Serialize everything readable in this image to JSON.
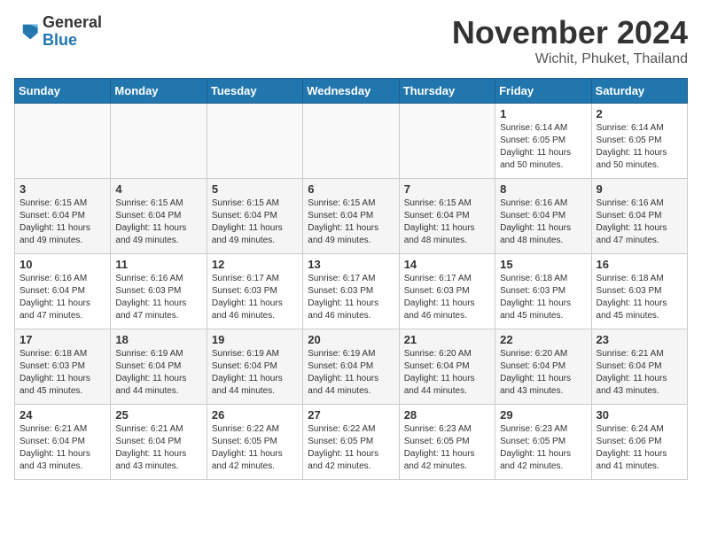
{
  "header": {
    "logo": {
      "general": "General",
      "blue": "Blue"
    },
    "month": "November 2024",
    "location": "Wichit, Phuket, Thailand"
  },
  "days_of_week": [
    "Sunday",
    "Monday",
    "Tuesday",
    "Wednesday",
    "Thursday",
    "Friday",
    "Saturday"
  ],
  "weeks": [
    [
      {
        "day": null
      },
      {
        "day": null
      },
      {
        "day": null
      },
      {
        "day": null
      },
      {
        "day": null
      },
      {
        "day": "1",
        "sunrise": "6:14 AM",
        "sunset": "6:05 PM",
        "daylight": "11 hours and 50 minutes."
      },
      {
        "day": "2",
        "sunrise": "6:14 AM",
        "sunset": "6:05 PM",
        "daylight": "11 hours and 50 minutes."
      }
    ],
    [
      {
        "day": "3",
        "sunrise": "6:15 AM",
        "sunset": "6:04 PM",
        "daylight": "11 hours and 49 minutes."
      },
      {
        "day": "4",
        "sunrise": "6:15 AM",
        "sunset": "6:04 PM",
        "daylight": "11 hours and 49 minutes."
      },
      {
        "day": "5",
        "sunrise": "6:15 AM",
        "sunset": "6:04 PM",
        "daylight": "11 hours and 49 minutes."
      },
      {
        "day": "6",
        "sunrise": "6:15 AM",
        "sunset": "6:04 PM",
        "daylight": "11 hours and 49 minutes."
      },
      {
        "day": "7",
        "sunrise": "6:15 AM",
        "sunset": "6:04 PM",
        "daylight": "11 hours and 48 minutes."
      },
      {
        "day": "8",
        "sunrise": "6:16 AM",
        "sunset": "6:04 PM",
        "daylight": "11 hours and 48 minutes."
      },
      {
        "day": "9",
        "sunrise": "6:16 AM",
        "sunset": "6:04 PM",
        "daylight": "11 hours and 47 minutes."
      }
    ],
    [
      {
        "day": "10",
        "sunrise": "6:16 AM",
        "sunset": "6:04 PM",
        "daylight": "11 hours and 47 minutes."
      },
      {
        "day": "11",
        "sunrise": "6:16 AM",
        "sunset": "6:03 PM",
        "daylight": "11 hours and 47 minutes."
      },
      {
        "day": "12",
        "sunrise": "6:17 AM",
        "sunset": "6:03 PM",
        "daylight": "11 hours and 46 minutes."
      },
      {
        "day": "13",
        "sunrise": "6:17 AM",
        "sunset": "6:03 PM",
        "daylight": "11 hours and 46 minutes."
      },
      {
        "day": "14",
        "sunrise": "6:17 AM",
        "sunset": "6:03 PM",
        "daylight": "11 hours and 46 minutes."
      },
      {
        "day": "15",
        "sunrise": "6:18 AM",
        "sunset": "6:03 PM",
        "daylight": "11 hours and 45 minutes."
      },
      {
        "day": "16",
        "sunrise": "6:18 AM",
        "sunset": "6:03 PM",
        "daylight": "11 hours and 45 minutes."
      }
    ],
    [
      {
        "day": "17",
        "sunrise": "6:18 AM",
        "sunset": "6:03 PM",
        "daylight": "11 hours and 45 minutes."
      },
      {
        "day": "18",
        "sunrise": "6:19 AM",
        "sunset": "6:04 PM",
        "daylight": "11 hours and 44 minutes."
      },
      {
        "day": "19",
        "sunrise": "6:19 AM",
        "sunset": "6:04 PM",
        "daylight": "11 hours and 44 minutes."
      },
      {
        "day": "20",
        "sunrise": "6:19 AM",
        "sunset": "6:04 PM",
        "daylight": "11 hours and 44 minutes."
      },
      {
        "day": "21",
        "sunrise": "6:20 AM",
        "sunset": "6:04 PM",
        "daylight": "11 hours and 44 minutes."
      },
      {
        "day": "22",
        "sunrise": "6:20 AM",
        "sunset": "6:04 PM",
        "daylight": "11 hours and 43 minutes."
      },
      {
        "day": "23",
        "sunrise": "6:21 AM",
        "sunset": "6:04 PM",
        "daylight": "11 hours and 43 minutes."
      }
    ],
    [
      {
        "day": "24",
        "sunrise": "6:21 AM",
        "sunset": "6:04 PM",
        "daylight": "11 hours and 43 minutes."
      },
      {
        "day": "25",
        "sunrise": "6:21 AM",
        "sunset": "6:04 PM",
        "daylight": "11 hours and 43 minutes."
      },
      {
        "day": "26",
        "sunrise": "6:22 AM",
        "sunset": "6:05 PM",
        "daylight": "11 hours and 42 minutes."
      },
      {
        "day": "27",
        "sunrise": "6:22 AM",
        "sunset": "6:05 PM",
        "daylight": "11 hours and 42 minutes."
      },
      {
        "day": "28",
        "sunrise": "6:23 AM",
        "sunset": "6:05 PM",
        "daylight": "11 hours and 42 minutes."
      },
      {
        "day": "29",
        "sunrise": "6:23 AM",
        "sunset": "6:05 PM",
        "daylight": "11 hours and 42 minutes."
      },
      {
        "day": "30",
        "sunrise": "6:24 AM",
        "sunset": "6:06 PM",
        "daylight": "11 hours and 41 minutes."
      }
    ]
  ]
}
